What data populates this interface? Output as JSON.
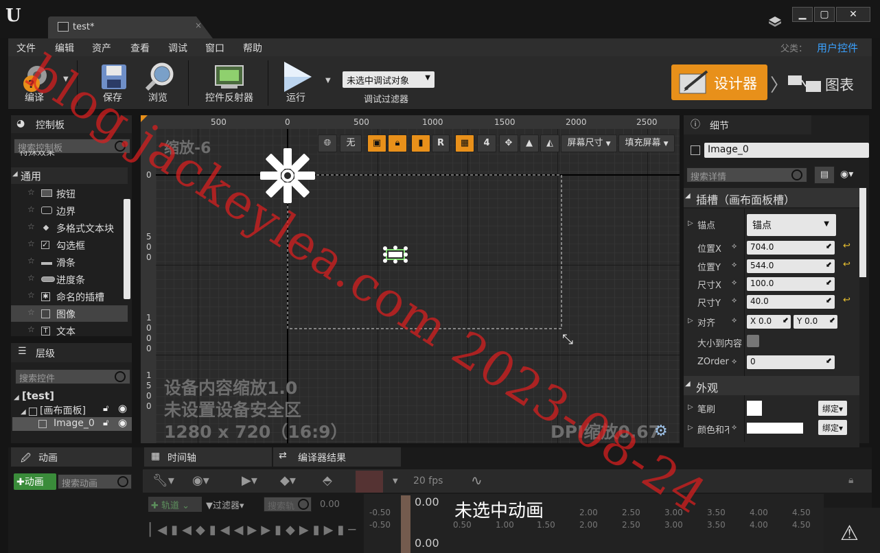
{
  "window": {
    "tab_title": "test*",
    "parent_label": "父类：",
    "parent_value": "用户控件"
  },
  "menu": [
    "文件",
    "编辑",
    "资产",
    "查看",
    "调试",
    "窗口",
    "帮助"
  ],
  "toolbar": {
    "compile": "编译",
    "save": "保存",
    "browse": "浏览",
    "widget_reflector": "控件反射器",
    "run": "运行",
    "debug_select": "未选中调试对象",
    "debug_filter": "调试过滤器",
    "designer": "设计器",
    "graph": "图表"
  },
  "palette": {
    "title": "控制板",
    "search_placeholder": "搜索控制板",
    "partial_row": "特殊效果",
    "category": "通用",
    "items": [
      "按钮",
      "边界",
      "多格式文本块",
      "勾选框",
      "滑条",
      "进度条",
      "命名的插槽",
      "图像",
      "文本"
    ]
  },
  "hierarchy": {
    "title": "层级",
    "search_placeholder": "搜索控件",
    "root": "[test]",
    "canvas": "[画布面板]",
    "image": "Image_0"
  },
  "viewport": {
    "zoom": "缩放-6",
    "ruler_h": [
      "500",
      "0",
      "500",
      "1000",
      "1500",
      "2000",
      "2500"
    ],
    "ruler_v": [
      "0",
      "5\n0\n0",
      "1\n0\n0\n0",
      "1\n5\n0\n0"
    ],
    "none_label": "无",
    "r_label": "R",
    "grid_number": "4",
    "screen_size": "屏幕尺寸",
    "fill_screen": "填充屏幕",
    "device_scale": "设备内容缩放1.0",
    "safe_zone": "未设置设备安全区",
    "resolution": "1280 x 720（16:9）",
    "dpi": "DPI缩放0.67"
  },
  "details": {
    "title": "细节",
    "name_value": "Image_0",
    "search_placeholder": "搜索详情",
    "slot_section": "插槽（画布面板槽）",
    "anchor_label": "锚点",
    "anchor_value": "锚点",
    "pos_x_label": "位置X",
    "pos_x": "704.0",
    "pos_y_label": "位置Y",
    "pos_y": "544.0",
    "size_x_label": "尺寸X",
    "size_x": "100.0",
    "size_y_label": "尺寸Y",
    "size_y": "40.0",
    "align_label": "对齐",
    "align_x": "X  0.0",
    "align_y": "Y  0.0",
    "size_to_content": "大小到内容",
    "zorder_label": "ZOrder",
    "zorder": "0",
    "appearance_section": "外观",
    "brush_label": "笔刷",
    "color_label": "颜色和不",
    "bind_label": "绑定"
  },
  "bottom": {
    "animation_tab": "动画",
    "add_animation": "动画",
    "search_animation": "搜索动画",
    "timeline_tab": "时间轴",
    "compiler_tab": "编译器结果",
    "fps": "20 fps",
    "track_btn": "轨道",
    "filter_btn": "过滤器",
    "search_track": "搜索轨",
    "time_value": "0.00",
    "playhead_top": "0.00",
    "playhead_bottom": "0.00",
    "no_animation": "未选中动画",
    "timeline_labels": [
      "-0.50",
      "0.50",
      "1.00",
      "1.50",
      "2.00",
      "2.50",
      "3.00",
      "3.50",
      "4.00",
      "4.50"
    ]
  },
  "watermark": "blog.jackeylea.com 2023-08-24",
  "colors": {
    "accent_orange": "#e8901a",
    "link_blue": "#3aa1ff",
    "watermark_red": "#dc1e1e"
  }
}
